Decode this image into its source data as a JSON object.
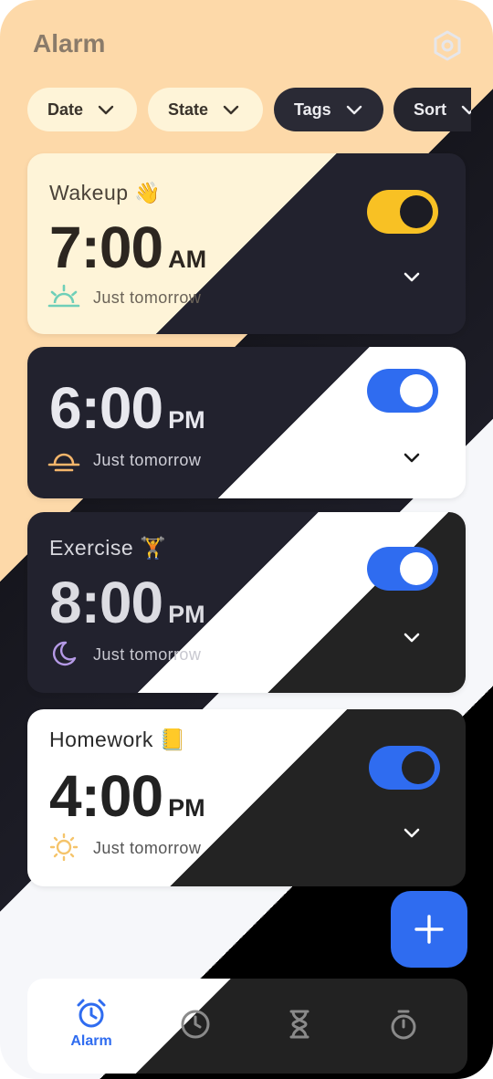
{
  "app": {
    "title": "Alarm"
  },
  "filters": [
    {
      "label": "Date"
    },
    {
      "label": "State"
    },
    {
      "label": "Tags"
    },
    {
      "label": "Sort"
    }
  ],
  "alarms": [
    {
      "label": "Wakeup 👋",
      "time": "7:00",
      "period": "AM",
      "repeat": "Just tomorrow",
      "enabled": true,
      "icon": "sunrise-icon"
    },
    {
      "label": "",
      "time": "6:00",
      "period": "PM",
      "repeat": "Just tomorrow",
      "enabled": true,
      "icon": "sunset-icon"
    },
    {
      "label": "Exercise 🏋",
      "time": "8:00",
      "period": "PM",
      "repeat": "Just tomorrow",
      "enabled": true,
      "icon": "moon-icon"
    },
    {
      "label": "Homework 📒",
      "time": "4:00",
      "period": "PM",
      "repeat": "Just tomorrow",
      "enabled": true,
      "icon": "sun-icon"
    }
  ],
  "nav": {
    "items": [
      {
        "label": "Alarm",
        "icon": "alarm-clock-icon",
        "active": true
      },
      {
        "label": "",
        "icon": "clock-icon",
        "active": false
      },
      {
        "label": "",
        "icon": "hourglass-icon",
        "active": false
      },
      {
        "label": "",
        "icon": "stopwatch-icon",
        "active": false
      }
    ]
  },
  "colors": {
    "accent": "#2f6cf0",
    "toggle_yellow": "#f8c124",
    "peach": "#fdd9a9",
    "cream": "#fef4d8"
  }
}
